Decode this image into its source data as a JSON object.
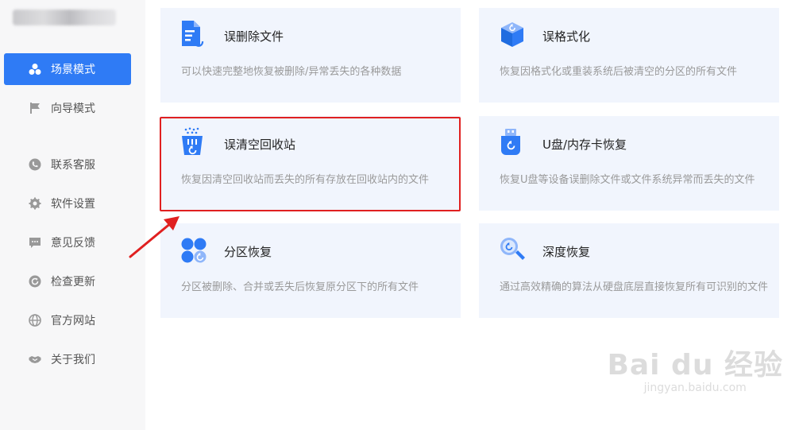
{
  "sidebar": {
    "items": [
      {
        "label": "场景模式",
        "icon": "scene-icon",
        "active": true
      },
      {
        "label": "向导模式",
        "icon": "flag-icon"
      },
      {
        "label": "联系客服",
        "icon": "phone-icon"
      },
      {
        "label": "软件设置",
        "icon": "gear-icon"
      },
      {
        "label": "意见反馈",
        "icon": "chat-icon"
      },
      {
        "label": "检查更新",
        "icon": "refresh-icon"
      },
      {
        "label": "官方网站",
        "icon": "globe-icon"
      },
      {
        "label": "关于我们",
        "icon": "handshake-icon"
      }
    ]
  },
  "cards": [
    {
      "title": "误删除文件",
      "desc": "可以快速完整地恢复被删除/异常丢失的各种数据",
      "icon": "file-restore-icon"
    },
    {
      "title": "误格式化",
      "desc": "恢复因格式化或重装系统后被清空的分区的所有文件",
      "icon": "cube-restore-icon"
    },
    {
      "title": "误清空回收站",
      "desc": "恢复因清空回收站而丢失的所有存放在回收站内的文件",
      "icon": "recycle-bin-icon"
    },
    {
      "title": "U盘/内存卡恢复",
      "desc": "恢复U盘等设备误删除文件或文件系统异常而丢失的文件",
      "icon": "usb-drive-icon"
    },
    {
      "title": "分区恢复",
      "desc": "分区被删除、合并或丢失后恢复原分区下的所有文件",
      "icon": "partition-icon"
    },
    {
      "title": "深度恢复",
      "desc": "通过高效精确的算法从硬盘底层直接恢复所有可识别的文件",
      "icon": "deep-search-icon"
    }
  ],
  "watermark": {
    "main": "Bai du 经验",
    "sub": "jingyan.baidu.com"
  },
  "colors": {
    "accent": "#2f7bf5",
    "card_bg": "#f1f5fd",
    "highlight": "#e02020"
  }
}
